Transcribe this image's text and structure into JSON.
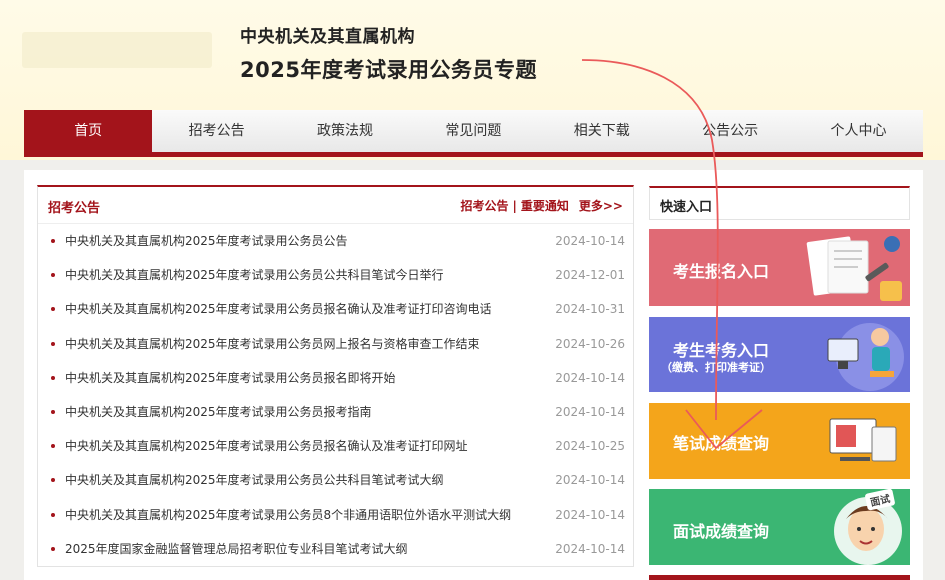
{
  "header": {
    "org": "中央机关及其直属机构",
    "title": "2025年度考试录用公务员专题"
  },
  "nav": {
    "items": [
      "首页",
      "招考公告",
      "政策法规",
      "常见问题",
      "相关下载",
      "公告公示",
      "个人中心"
    ]
  },
  "news": {
    "title": "招考公告",
    "link1": "招考公告",
    "sep": "|",
    "link2": "重要通知",
    "more": "更多>>",
    "items": [
      {
        "text": "中央机关及其直属机构2025年度考试录用公务员公告",
        "date": "2024-10-14"
      },
      {
        "text": "中央机关及其直属机构2025年度考试录用公务员公共科目笔试今日举行",
        "date": "2024-12-01"
      },
      {
        "text": "中央机关及其直属机构2025年度考试录用公务员报名确认及准考证打印咨询电话",
        "date": "2024-10-31"
      },
      {
        "text": "中央机关及其直属机构2025年度考试录用公务员网上报名与资格审查工作结束",
        "date": "2024-10-26"
      },
      {
        "text": "中央机关及其直属机构2025年度考试录用公务员报名即将开始",
        "date": "2024-10-14"
      },
      {
        "text": "中央机关及其直属机构2025年度考试录用公务员报考指南",
        "date": "2024-10-14"
      },
      {
        "text": "中央机关及其直属机构2025年度考试录用公务员报名确认及准考证打印网址",
        "date": "2024-10-25"
      },
      {
        "text": "中央机关及其直属机构2025年度考试录用公务员公共科目笔试考试大纲",
        "date": "2024-10-14"
      },
      {
        "text": "中央机关及其直属机构2025年度考试录用公务员8个非通用语职位外语水平测试大纲",
        "date": "2024-10-14"
      },
      {
        "text": "2025年度国家金融监督管理总局招考职位专业科目笔试考试大纲",
        "date": "2024-10-14"
      }
    ]
  },
  "quick": {
    "title": "快速入口",
    "btn1": "考生报名入口",
    "btn2": "考生考务入口",
    "btn2_sub": "（缴费、打印准考证）",
    "btn3": "笔试成绩查询",
    "btn4": "面试成绩查询",
    "badge4": "面试"
  },
  "colors": {
    "brand": "#a3141b",
    "btn1": "#e06a75",
    "btn2": "#6b73d9",
    "btn3": "#f4a51b",
    "btn4": "#3bb673"
  }
}
